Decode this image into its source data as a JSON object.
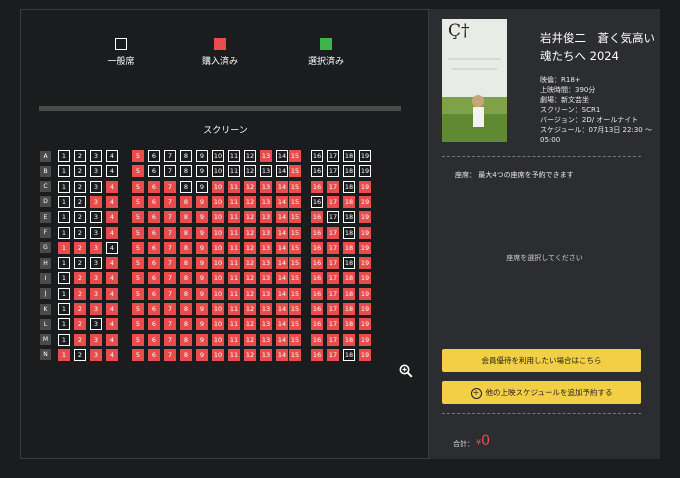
{
  "legend": {
    "available": "一般席",
    "sold": "購入済み",
    "selected": "選択済み"
  },
  "screen_label": "スクリーン",
  "colors": {
    "sold": "#e84c4c",
    "selected": "#3cb54a",
    "accent": "#f2cf45"
  },
  "rows": [
    {
      "label": "A",
      "seats": "EEEEsEEEEEEEsEsEEEE"
    },
    {
      "label": "B",
      "seats": "EEEEsEEEEEEEEEsEEEE"
    },
    {
      "label": "C",
      "seats": "EEEssssEEssssssssEsE"
    },
    {
      "label": "D",
      "seats": "EEsssssssssssssEsss"
    },
    {
      "label": "E",
      "seats": "EEEsssssssssssssEEs"
    },
    {
      "label": "F",
      "seats": "EEEssssssssssssssEss"
    },
    {
      "label": "G",
      "seats": "sssEssssssssssssssss"
    },
    {
      "label": "H",
      "seats": "EEEssssssssssssssEss"
    },
    {
      "label": "I",
      "seats": "Essssssssssssssssss"
    },
    {
      "label": "J",
      "seats": "Esssssssssssssssssss"
    },
    {
      "label": "K",
      "seats": "Esssssssssssssssssss"
    },
    {
      "label": "L",
      "seats": "EsEssssssssssssssss"
    },
    {
      "label": "M",
      "seats": "Esssssssssssssssssss"
    },
    {
      "label": "N",
      "seats": "sEsssssssssssssssEss"
    }
  ],
  "movie": {
    "title": "岩井俊二　蒼く気高い魂たちへ 2024",
    "rating": "映倫：R18+",
    "duration": "上映時間：390分",
    "theater": "劇場：新文芸坐",
    "screen": "スクリーン：SCR1",
    "version": "バージョン：2D/ オールナイト",
    "schedule": "スケジュール：07月13日 22:30 ～ 05:00",
    "poster_text": "Ç†"
  },
  "seat_note": "座席：  最大4つの座席を予約できます",
  "select_msg": "座席を選択してください",
  "buttons": {
    "member": "会員優待を利用したい場合はこちら",
    "add_schedule": "他の上映スケジュールを追加予約する"
  },
  "total": {
    "label": "合計：",
    "currency": "¥",
    "value": "0"
  }
}
